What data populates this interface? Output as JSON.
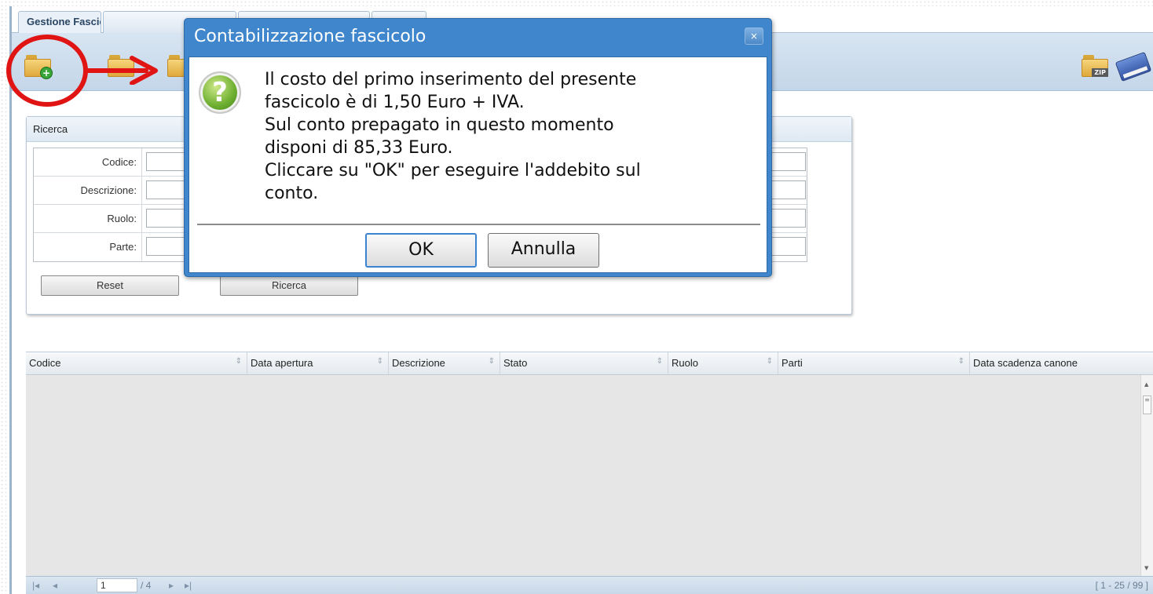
{
  "tabs": [
    {
      "label": "Gestione Fascicoli",
      "active": true
    },
    {
      "label": "",
      "active": false
    },
    {
      "label": "",
      "active": false
    },
    {
      "label": "",
      "active": false
    }
  ],
  "toolbar": {
    "icons": [
      "new-folder-icon",
      "folder-icon",
      "folder-icon",
      "zip-folder-icon",
      "book-icon"
    ],
    "zip_label": "ZIP"
  },
  "search": {
    "title": "Ricerca",
    "fields": [
      {
        "label": "Codice:",
        "value": ""
      },
      {
        "label": "Descrizione:",
        "value": ""
      },
      {
        "label": "Ruolo:",
        "value": ""
      },
      {
        "label": "Parte:",
        "value": ""
      }
    ],
    "reset_label": "Reset",
    "search_label": "Ricerca"
  },
  "grid": {
    "columns": [
      "Codice",
      "Data apertura",
      "Descrizione",
      "Stato",
      "Ruolo",
      "Parti",
      "Data scadenza canone"
    ],
    "rows": []
  },
  "pager": {
    "current_page": "1",
    "total_pages": "/ 4",
    "range": "[ 1 - 25 / 99 ]"
  },
  "dialog": {
    "title": "Contabilizzazione fascicolo",
    "close_label": "×",
    "message_lines": [
      "Il costo del primo inserimento del presente",
      "fascicolo è di 1,50 Euro + IVA.",
      "Sul conto prepagato in questo momento",
      "disponi di 85,33 Euro.",
      "Cliccare su \"OK\" per eseguire l'addebito sul",
      "conto."
    ],
    "ok_label": "OK",
    "cancel_label": "Annulla"
  },
  "colors": {
    "dialog_title_bar": "#3f86cc",
    "annotation_red": "#e11414",
    "toolbar_bg": "#c4d6e9"
  }
}
